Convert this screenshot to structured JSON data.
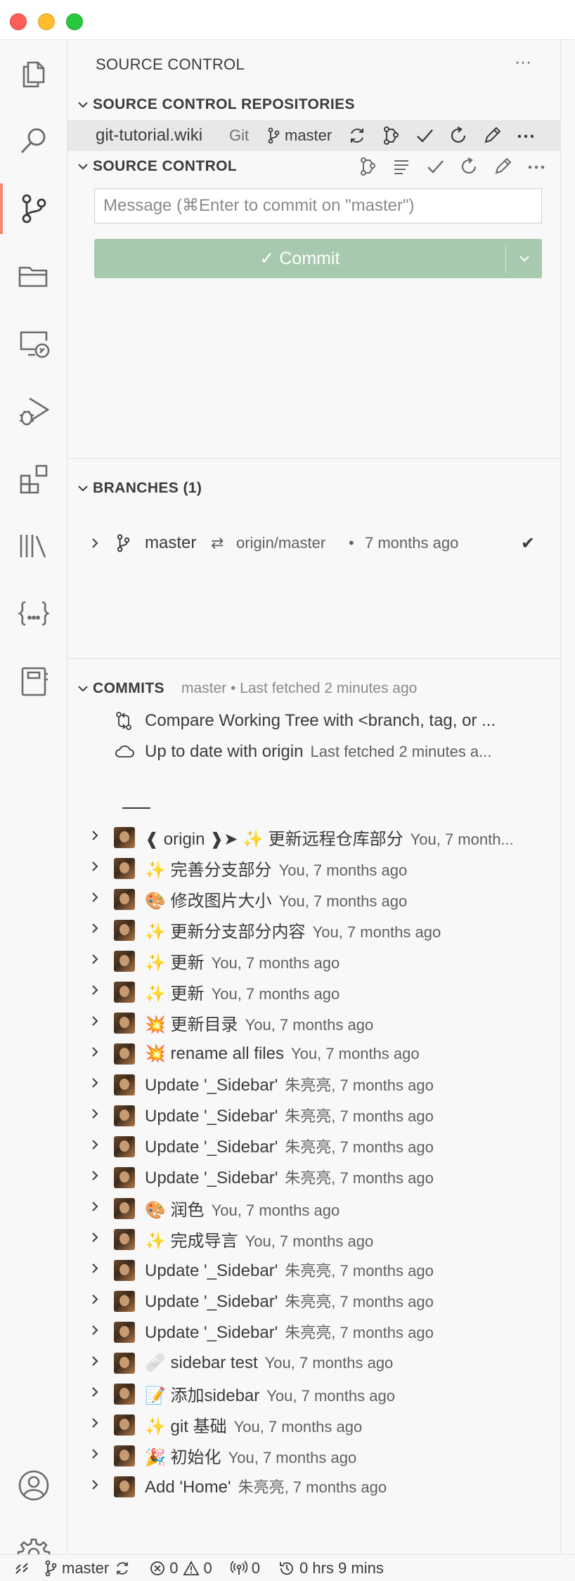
{
  "view": {
    "title": "SOURCE CONTROL",
    "more": "···"
  },
  "repositories": {
    "title": "SOURCE CONTROL REPOSITORIES",
    "repo_name": "git-tutorial.wiki",
    "repo_type": "Git",
    "branch": "master"
  },
  "source_control": {
    "title": "SOURCE CONTROL",
    "message_placeholder": "Message (⌘Enter to commit on \"master\")",
    "commit_label": "✓ Commit"
  },
  "branches": {
    "title": "BRANCHES (1)",
    "items": [
      {
        "name": "master",
        "sync": "⇄",
        "upstream": "origin/master",
        "dot": "•",
        "time": "7 months ago",
        "check": "✔"
      }
    ]
  },
  "commits": {
    "title": "COMMITS",
    "meta": "master • Last fetched 2 minutes ago",
    "compare": "Compare Working Tree with <branch, tag, or ...",
    "uptodate": "Up to date with origin",
    "uptodate_desc": "Last fetched 2 minutes a...",
    "items": [
      {
        "message": "❰ origin ❱➤ ✨ 更新远程仓库部分",
        "meta": "You, 7 month..."
      },
      {
        "message": "✨ 完善分支部分",
        "meta": "You, 7 months ago"
      },
      {
        "message": "🎨 修改图片大小",
        "meta": "You, 7 months ago"
      },
      {
        "message": "✨ 更新分支部分内容",
        "meta": "You, 7 months ago"
      },
      {
        "message": "✨ 更新",
        "meta": "You, 7 months ago"
      },
      {
        "message": "✨ 更新",
        "meta": "You, 7 months ago"
      },
      {
        "message": "💥 更新目录",
        "meta": "You, 7 months ago"
      },
      {
        "message": "💥 rename all files",
        "meta": "You, 7 months ago"
      },
      {
        "message": "Update '_Sidebar'",
        "meta": "朱亮亮, 7 months ago"
      },
      {
        "message": "Update '_Sidebar'",
        "meta": "朱亮亮, 7 months ago"
      },
      {
        "message": "Update '_Sidebar'",
        "meta": "朱亮亮, 7 months ago"
      },
      {
        "message": "Update '_Sidebar'",
        "meta": "朱亮亮, 7 months ago"
      },
      {
        "message": "🎨 润色",
        "meta": "You, 7 months ago"
      },
      {
        "message": "✨ 完成导言",
        "meta": "You, 7 months ago"
      },
      {
        "message": "Update '_Sidebar'",
        "meta": "朱亮亮, 7 months ago"
      },
      {
        "message": "Update '_Sidebar'",
        "meta": "朱亮亮, 7 months ago"
      },
      {
        "message": "Update '_Sidebar'",
        "meta": "朱亮亮, 7 months ago"
      },
      {
        "message": "🩹 sidebar test",
        "meta": "You, 7 months ago"
      },
      {
        "message": "📝 添加sidebar",
        "meta": "You, 7 months ago"
      },
      {
        "message": "✨ git 基础",
        "meta": "You, 7 months ago"
      },
      {
        "message": "🎉 初始化",
        "meta": "You, 7 months ago"
      },
      {
        "message": "Add 'Home'",
        "meta": "朱亮亮, 7 months ago"
      }
    ]
  },
  "status_bar": {
    "branch": "master",
    "errors": "0",
    "warnings": "0",
    "ports": "0",
    "time": "0 hrs 9 mins"
  },
  "colors": {
    "accent": "#f5876a",
    "commit_button": "#a7c9ad",
    "background": "#f8f8f8"
  },
  "icons": [
    "explorer-icon",
    "search-icon",
    "source-control-icon",
    "folder-icon",
    "remote-explorer-icon",
    "run-debug-icon",
    "extensions-icon",
    "library-icon",
    "json-braces-icon",
    "notebook-icon",
    "account-icon",
    "gear-icon"
  ]
}
